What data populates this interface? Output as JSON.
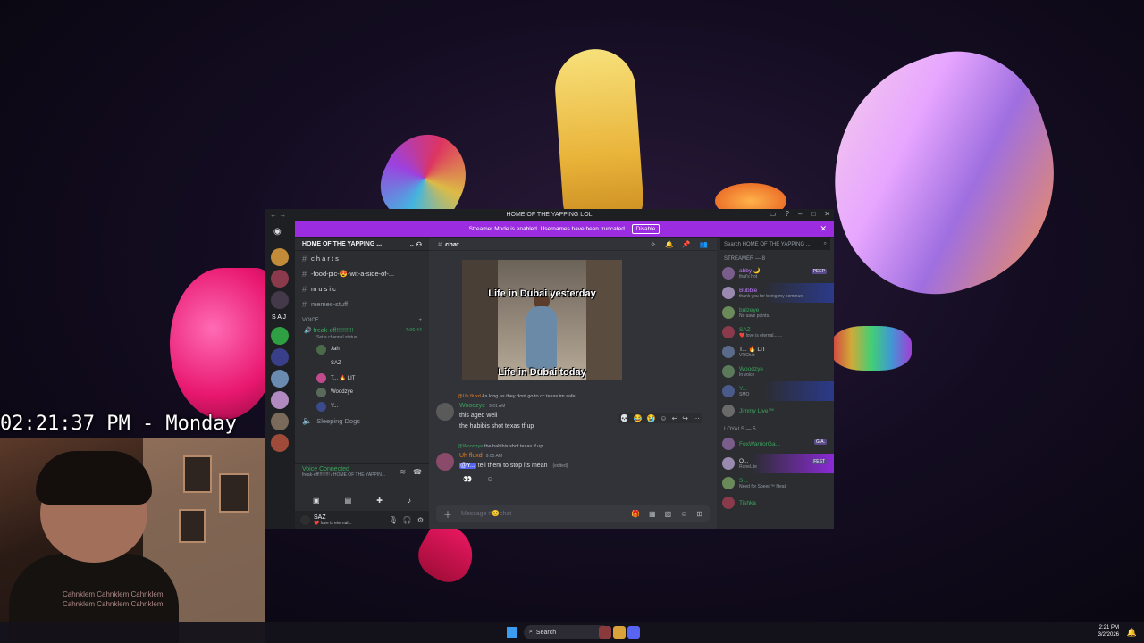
{
  "overlay": {
    "clock": "02:21:37 PM - Monday"
  },
  "webcam": {
    "shirt_text": [
      "Cahnklem Cahnklem Cahnklem",
      "Cahnklem Cahnklem Cahnklem"
    ]
  },
  "window": {
    "title": "HOME OF THE YAPPING LOL",
    "banner": {
      "text": "Streamer Mode is enabled. Usernames have been truncated.",
      "button": "Disable"
    }
  },
  "server_list": {
    "label": "S A J"
  },
  "sidebar": {
    "guild_name": "HOME OF THE YAPPING ...",
    "channels": [
      {
        "label": "c h a r t s"
      },
      {
        "label": "-food-pic-😍-wit-a-side-of-..."
      },
      {
        "label": "m u s i c"
      },
      {
        "label": "memes-stuff"
      }
    ],
    "voice_section": "VOICE",
    "voice_channel": {
      "name": "freak-off!!!!!!!!!!",
      "timer": "7:06:44",
      "status": "Set a channel status"
    },
    "voice_users": [
      "Jah",
      "SAZ",
      "T... 🔥 LIT",
      "Woodzye",
      "Y..."
    ],
    "sleeping_channel": "Sleeping Dogs",
    "voice_connected": {
      "title": "Voice Connected",
      "subtitle": "freak-off!!!!!!!!! / HOME OF THE YAPPIN..."
    },
    "user_panel": {
      "name": "SAZ",
      "status": "❤️ love is eternal..."
    }
  },
  "chat": {
    "channel_name": "chat",
    "gif_caption_top": "Life in Dubai yesterday",
    "gif_caption_bottom": "Life in Dubai today",
    "messages": [
      {
        "reply_to_user": "@Uh fluxd",
        "reply_to_text": "As long as they dont go to cc texas im safe",
        "author": "Woodzye",
        "time": "9:01 AM",
        "lines": [
          "this aged well",
          "the habibis shot texas tf up"
        ]
      },
      {
        "reply_to_user": "@Woodzye",
        "reply_to_text": "the habibis shot texas tf up",
        "author": "Uh fluxd",
        "time": "9:05 AM",
        "mention": "@Y...",
        "text": "tell them to stop  its mean",
        "edited": "(edited)"
      }
    ],
    "composer_placeholder": "Message #😊chat"
  },
  "members": {
    "search_placeholder": "Search HOME OF THE YAPPING ...",
    "groups": [
      {
        "title": "STREAMER — 8",
        "items": [
          {
            "name": "abby 🌙",
            "badge": "PEEP",
            "status": "that's hot",
            "color": "#c27cff"
          },
          {
            "name": "Bubble",
            "status": "thank you for being my commun",
            "color": "#c27cff"
          },
          {
            "name": "bulzeye",
            "status": "No save points.",
            "color": "#3ba55c"
          },
          {
            "name": "SAZ",
            "status": "❤️ love is eternal.......",
            "color": "#3ba55c"
          },
          {
            "name": "T... 🔥 LIT",
            "status": "VRChat",
            "color": "#dbdee1"
          },
          {
            "name": "Woodzye",
            "status": "In voice",
            "color": "#3ba55c"
          },
          {
            "name": "Y...",
            "status": "SMO",
            "color": "#3ba55c"
          },
          {
            "name": "Jimmy Live™",
            "status": "",
            "color": "#3ba55c"
          }
        ]
      },
      {
        "title": "LOYALS — 5",
        "items": [
          {
            "name": "FoxWarriorGa...",
            "badge": "G.A.",
            "status": "",
            "color": "#3ba55c"
          },
          {
            "name": "O...",
            "badge": "FEST",
            "status": "RuneLite",
            "color": "#dbdee1"
          },
          {
            "name": "S...",
            "status": "Need for Speed™ Heat",
            "color": "#3ba55c"
          },
          {
            "name": "Tishka",
            "status": "",
            "color": "#3ba55c"
          }
        ]
      }
    ]
  },
  "taskbar": {
    "search": "Search",
    "time": "2:21 PM",
    "date": "3/2/2026"
  }
}
